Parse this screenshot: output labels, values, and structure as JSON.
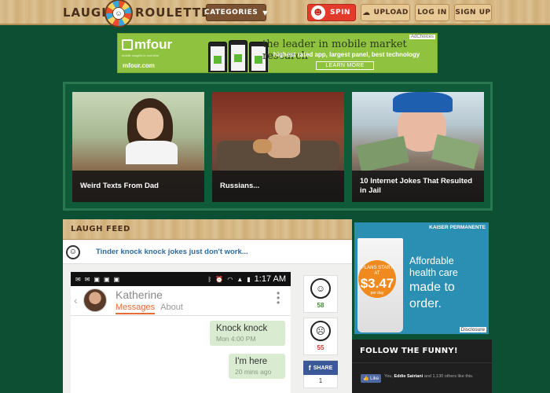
{
  "header": {
    "logo_left": "LAUGH",
    "logo_right": "ROULETTE",
    "categories_label": "CATEGORIES",
    "spin_label": "SPIN",
    "upload_label": "UPLOAD",
    "login_label": "LOG IN",
    "signup_label": "SIGN UP"
  },
  "top_ad": {
    "brand": "mfour",
    "brand_sub": "mobile insights in real time",
    "url": "mfour.com",
    "headline": "the leader in mobile market research",
    "subline": "highest rated app, largest panel, best technology",
    "cta": "LEARN MORE",
    "adchoices": "AdChoices",
    "color": "#8fc23e"
  },
  "featured": [
    {
      "caption": "Weird Texts From Dad"
    },
    {
      "caption": "Russians..."
    },
    {
      "caption": "10 Internet Jokes That Resulted in Jail"
    }
  ],
  "feed": {
    "title": "LAUGH FEED",
    "post_title": "Tinder knock knock jokes just don't work...",
    "screenshot": {
      "time": "1:17 AM",
      "contact": "Katherine",
      "tab_active": "Messages",
      "tab_other": "About",
      "messages": [
        {
          "text": "Knock knock",
          "meta": "Mon 4:00 PM"
        },
        {
          "text": "I'm here",
          "meta": "20 mins ago"
        }
      ]
    },
    "votes": {
      "up": "58",
      "down": "55"
    },
    "share_label": "SHARE",
    "share_count": "1"
  },
  "side_ad": {
    "brand": "KAISER PERMANENTE",
    "plans_text": "PLANS START AT",
    "price": "$3.47",
    "per_day": "per day",
    "line1": "Affordable",
    "line2": "health care",
    "line3": "made to",
    "line4": "order.",
    "disclosure": "Disclosure",
    "color": "#2a8fb2"
  },
  "follow": {
    "title": "FOLLOW THE FUNNY!",
    "like_label": "Like",
    "fb_you": "You,",
    "fb_name": "Eddie Satriani",
    "fb_rest": "and 1,130 others like this."
  },
  "colors": {
    "background": "#0d4f32",
    "spin_red": "#e23a2b",
    "link_blue": "#2d6aa0",
    "bubble_green": "#d9ebd0"
  }
}
